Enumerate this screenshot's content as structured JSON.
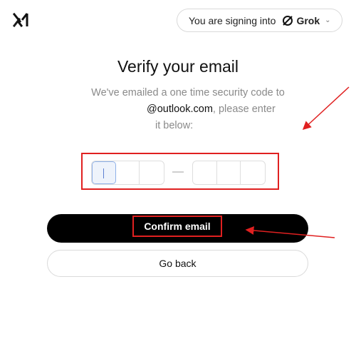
{
  "header": {
    "signin_prefix": "You are signing into",
    "brand_name": "Grok",
    "logo_icon": "xai-logo-icon",
    "brand_icon": "grok-logo-icon",
    "dropdown_icon": "chevron-down-icon"
  },
  "main": {
    "title": "Verify your email",
    "desc_line1": "We've emailed a one time security code to",
    "desc_email": "@outlook.com",
    "desc_line2_rest": ", please enter",
    "desc_line3": "it below:"
  },
  "code": {
    "digits": [
      "",
      "",
      "",
      "",
      "",
      ""
    ],
    "separator": "—"
  },
  "actions": {
    "confirm_label": "Confirm email",
    "back_label": "Go back"
  },
  "annotations": {
    "highlight_color": "#e02020"
  }
}
